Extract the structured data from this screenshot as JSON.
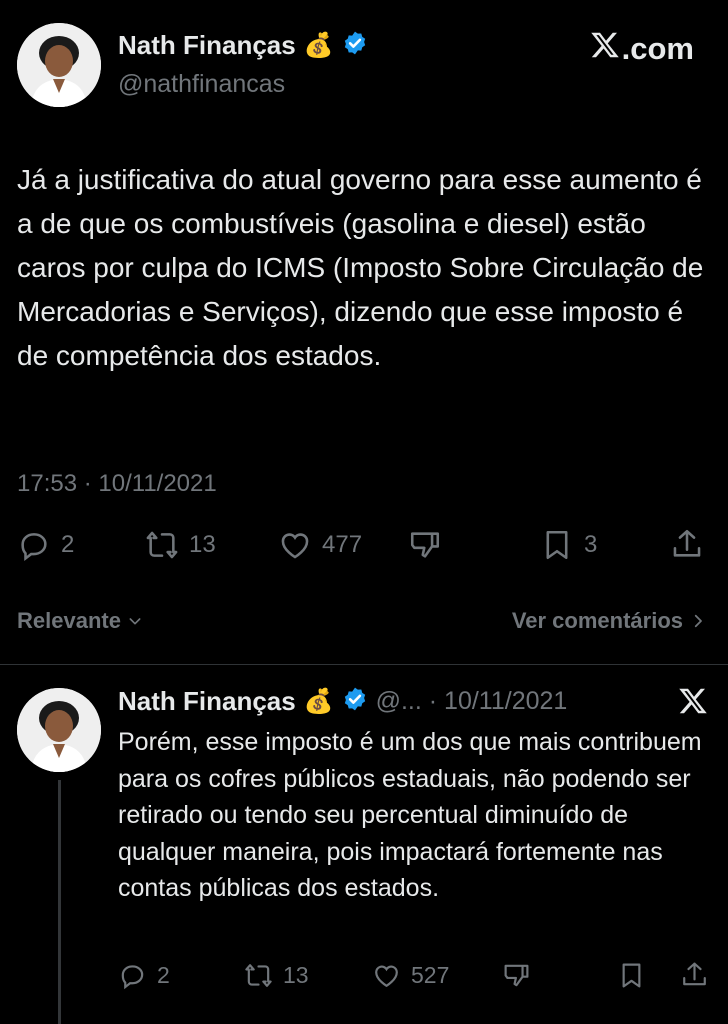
{
  "brand": {
    "label": ".com"
  },
  "main_tweet": {
    "author": {
      "name": "Nath Finanças",
      "emoji": "💰",
      "handle": "@nathfinancas",
      "verified": true
    },
    "text": "Já a justificativa do atual governo para esse aumento é a de que os combustíveis (gasolina e diesel) estão caros por culpa do ICMS (Imposto Sobre Circulação de Mercadorias e Serviços), dizendo que esse imposto é de competência dos estados.",
    "timestamp": "17:53 · 10/11/2021",
    "actions": {
      "replies": "2",
      "reposts": "13",
      "likes": "477",
      "bookmarks": "3"
    }
  },
  "sort": {
    "label": "Relevante",
    "view_comments": "Ver comentários"
  },
  "reply": {
    "author": {
      "name": "Nath Finanças",
      "emoji": "💰",
      "verified": true
    },
    "meta": "@... · 10/11/2021",
    "text": "Porém, esse imposto é um dos que mais contribuem para os cofres públicos estaduais, não podendo ser retirado ou tendo seu percentual diminuído de qualquer maneira, pois impactará fortemente nas contas públicas dos estados.",
    "actions": {
      "replies": "2",
      "reposts": "13",
      "likes": "527"
    }
  },
  "colors": {
    "background": "#000000",
    "text": "#e7e9ea",
    "muted": "#71767b",
    "verified": "#1d9bf0",
    "divider": "#2f3336"
  },
  "icons": [
    "x-logo-icon",
    "verified-badge-icon",
    "money-bag-emoji",
    "reply-icon",
    "repost-icon",
    "like-icon",
    "dislike-icon",
    "bookmark-icon",
    "share-icon",
    "chevron-down-icon",
    "chevron-right-icon"
  ]
}
